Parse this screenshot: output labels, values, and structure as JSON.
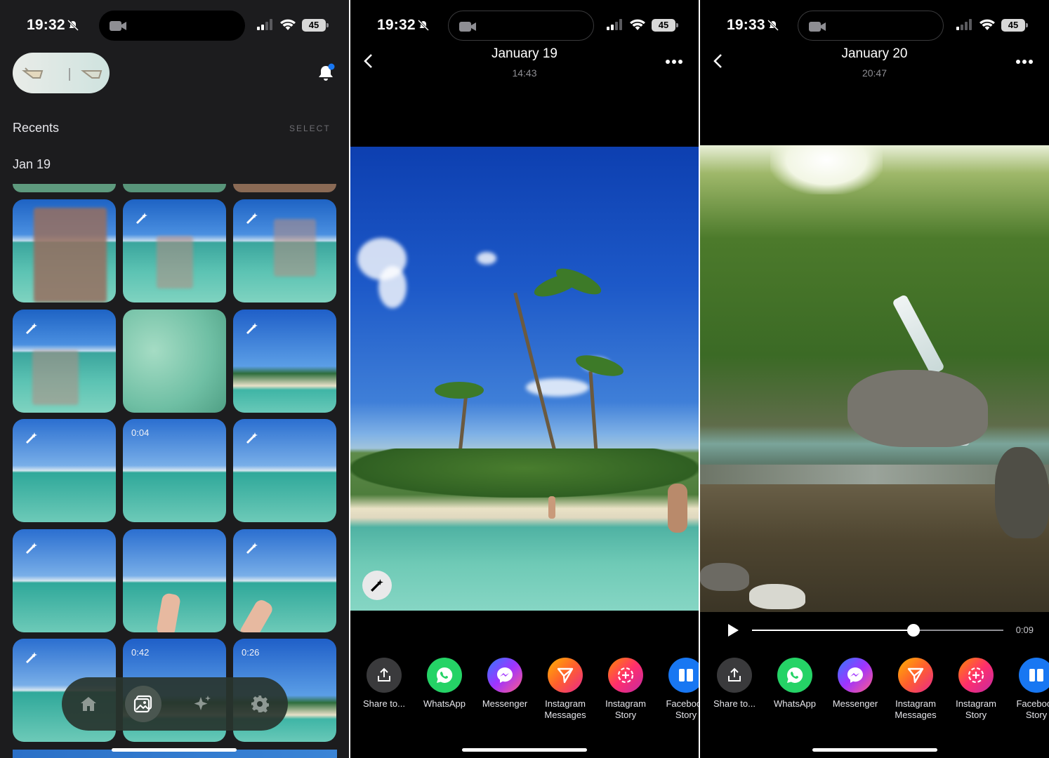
{
  "panels": [
    {
      "status": {
        "time": "19:32",
        "battery": "45"
      },
      "library": {
        "section_title": "Recents",
        "select_label": "SELECT",
        "date_header": "Jan 19",
        "tiles": [
          {
            "kind": "photo"
          },
          {
            "kind": "photo",
            "magic": true
          },
          {
            "kind": "photo",
            "magic": true
          },
          {
            "kind": "photo",
            "magic": true
          },
          {
            "kind": "photo"
          },
          {
            "kind": "photo",
            "magic": true
          },
          {
            "kind": "photo",
            "magic": true
          },
          {
            "kind": "video",
            "duration": "0:04"
          },
          {
            "kind": "photo",
            "magic": true
          },
          {
            "kind": "photo",
            "magic": true
          },
          {
            "kind": "photo"
          },
          {
            "kind": "photo",
            "magic": true
          },
          {
            "kind": "photo",
            "magic": true
          },
          {
            "kind": "video",
            "duration": "0:42"
          },
          {
            "kind": "video",
            "duration": "0:26"
          }
        ],
        "nav": [
          "home-icon",
          "gallery-icon",
          "sparkle-icon",
          "gear-icon"
        ]
      }
    },
    {
      "status": {
        "time": "19:32",
        "battery": "45"
      },
      "viewer": {
        "title": "January 19",
        "subtitle": "14:43"
      }
    },
    {
      "status": {
        "time": "19:33",
        "battery": "45"
      },
      "viewer": {
        "title": "January 20",
        "subtitle": "20:47"
      },
      "video": {
        "elapsed_fraction": 0.64,
        "time_label": "0:09"
      }
    }
  ],
  "share_targets": [
    {
      "label": "Share to...",
      "icon": "share-icon",
      "color": "#3a3a3c"
    },
    {
      "label": "WhatsApp",
      "icon": "whatsapp-icon",
      "color": "#25d366"
    },
    {
      "label": "Messenger",
      "icon": "messenger-icon",
      "color": "#a033ff"
    },
    {
      "label": "Instagram\nMessages",
      "icon": "instagram-direct-icon",
      "color": "#f9572b"
    },
    {
      "label": "Instagram\nStory",
      "icon": "instagram-story-icon",
      "color": "#f93b6d"
    },
    {
      "label": "Facebook\nStory",
      "icon": "facebook-story-icon",
      "color": "#1877f2"
    }
  ]
}
